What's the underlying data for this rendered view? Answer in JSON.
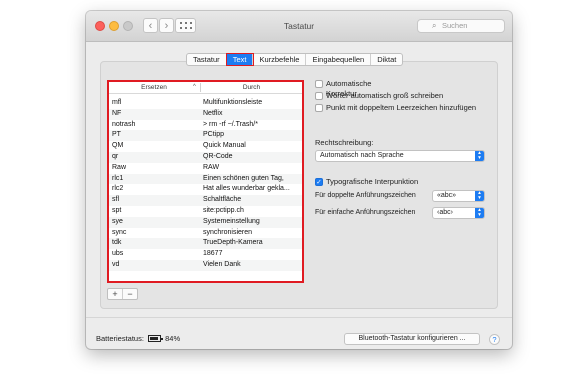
{
  "window": {
    "title": "Tastatur",
    "search_placeholder": "Suchen",
    "nav_back": "‹",
    "nav_forward": "›"
  },
  "tabs": [
    {
      "label": "Tastatur",
      "active": false
    },
    {
      "label": "Text",
      "active": true
    },
    {
      "label": "Kurzbefehle",
      "active": false
    },
    {
      "label": "Eingabequellen",
      "active": false
    },
    {
      "label": "Diktat",
      "active": false
    }
  ],
  "table": {
    "col_replace": "Ersetzen",
    "col_with": "Durch",
    "sort_indicator": "^",
    "rows": [
      {
        "replace": "mfl",
        "with": "Multifunktionsleiste"
      },
      {
        "replace": "NF",
        "with": "Netflix"
      },
      {
        "replace": "notrash",
        "with": "> rm -rf ~/.Trash/*"
      },
      {
        "replace": "PT",
        "with": "PCtipp"
      },
      {
        "replace": "QM",
        "with": "Quick Manual"
      },
      {
        "replace": "qr",
        "with": "QR-Code"
      },
      {
        "replace": "Raw",
        "with": "RAW"
      },
      {
        "replace": "rlc1",
        "with": "Einen schönen guten Tag,"
      },
      {
        "replace": "rlc2",
        "with": "Hat alles wunderbar gekla..."
      },
      {
        "replace": "sfl",
        "with": "Schaltfläche"
      },
      {
        "replace": "spt",
        "with": "site:pctipp.ch"
      },
      {
        "replace": "sye",
        "with": "Systemeinstellung"
      },
      {
        "replace": "sync",
        "with": "synchronisieren"
      },
      {
        "replace": "tdk",
        "with": "TrueDepth-Kamera"
      },
      {
        "replace": "ubs",
        "with": "18677"
      },
      {
        "replace": "vd",
        "with": "Vielen Dank"
      }
    ],
    "add": "+",
    "remove": "−"
  },
  "options": {
    "autocorrect": {
      "label": "Automatische Korrektur",
      "checked": false
    },
    "capitalize": {
      "label": "Wörter automatisch groß schreiben",
      "checked": false
    },
    "period": {
      "label": "Punkt mit doppeltem Leerzeichen hinzufügen",
      "checked": false
    },
    "spelling_heading": "Rechtschreibung:",
    "spelling_value": "Automatisch nach Sprache",
    "smart_quotes": {
      "label": "Typografische Interpunktion",
      "checked": true
    },
    "double_quotes_label": "Für doppelte Anführungszeichen",
    "double_quotes_value": "«abc»",
    "single_quotes_label": "Für einfache Anführungszeichen",
    "single_quotes_value": "‹abc›"
  },
  "footer": {
    "battery_label": "Batteriestatus:",
    "battery_value": "84%",
    "bt_button": "Bluetooth-Tastatur konfigurieren ...",
    "help": "?"
  },
  "colors": {
    "accent": "#1d7cf2",
    "highlight": "#e01b22"
  }
}
